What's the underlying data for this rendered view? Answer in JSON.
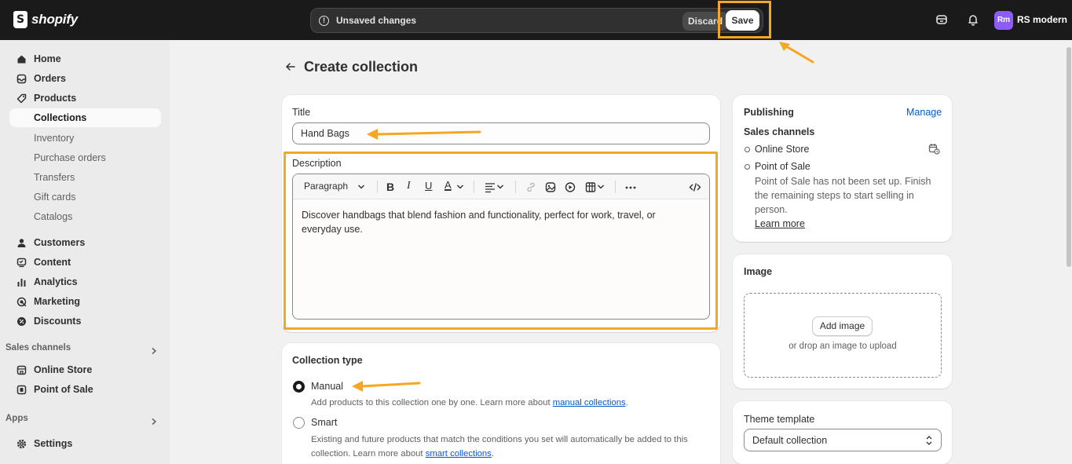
{
  "topbar": {
    "brand": "shopify",
    "unsaved_text": "Unsaved changes",
    "discard_label": "Discard",
    "save_label": "Save",
    "avatar_initials": "Rm",
    "store_name": "RS modern",
    "icons": [
      "shopify-bag-icon",
      "alert-circle-icon",
      "store-icon",
      "bell-icon"
    ]
  },
  "sidebar": {
    "items": [
      {
        "label": "Home",
        "icon": "home-icon"
      },
      {
        "label": "Orders",
        "icon": "inbox-icon"
      },
      {
        "label": "Products",
        "icon": "tag-icon"
      },
      {
        "label": "Collections"
      },
      {
        "label": "Inventory"
      },
      {
        "label": "Purchase orders"
      },
      {
        "label": "Transfers"
      },
      {
        "label": "Gift cards"
      },
      {
        "label": "Catalogs"
      },
      {
        "label": "Customers",
        "icon": "person-icon"
      },
      {
        "label": "Content",
        "icon": "content-icon"
      },
      {
        "label": "Analytics",
        "icon": "bar-chart-icon"
      },
      {
        "label": "Marketing",
        "icon": "target-icon"
      },
      {
        "label": "Discounts",
        "icon": "discount-icon"
      }
    ],
    "sales_channels_label": "Sales channels",
    "channels": [
      {
        "label": "Online Store",
        "icon": "storefront-icon"
      },
      {
        "label": "Point of Sale",
        "icon": "pos-icon"
      }
    ],
    "apps_label": "Apps",
    "settings_label": "Settings"
  },
  "page": {
    "title": "Create collection"
  },
  "form": {
    "title_label": "Title",
    "title_value": "Hand Bags",
    "description_label": "Description",
    "toolbar_paragraph": "Paragraph",
    "description_text": "Discover handbags that blend fashion and functionality, perfect for work, travel, or everyday use."
  },
  "collection_type": {
    "heading": "Collection type",
    "manual_label": "Manual",
    "manual_help_prefix": "Add products to this collection one by one. Learn more about ",
    "manual_help_link": "manual collections",
    "manual_help_suffix": ".",
    "smart_label": "Smart",
    "smart_help_line1": "Existing and future products that match the conditions you set will automatically be added to this",
    "smart_help_prefix": "collection. Learn more about ",
    "smart_help_link": "smart collections",
    "smart_help_suffix": ".",
    "selected": "Manual"
  },
  "publishing": {
    "heading": "Publishing",
    "manage_label": "Manage",
    "sales_channels_label": "Sales channels",
    "channel_online_store": "Online Store",
    "channel_pos": "Point of Sale",
    "pos_help": "Point of Sale has not been set up. Finish the remaining steps to start selling in person.",
    "learn_more": "Learn more"
  },
  "image": {
    "heading": "Image",
    "add_button": "Add image",
    "drop_text": "or drop an image to upload"
  },
  "theme_template": {
    "label": "Theme template",
    "value": "Default collection"
  },
  "colors": {
    "highlight": "#f5a623",
    "link": "#005bd3",
    "avatar": "#8b5cf6"
  }
}
